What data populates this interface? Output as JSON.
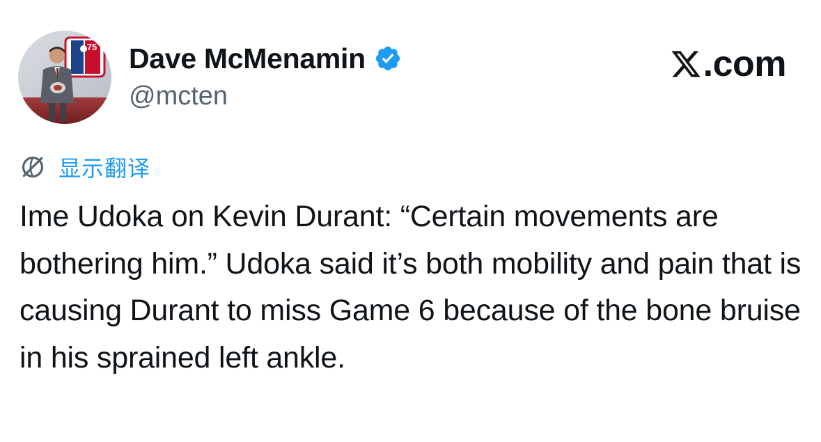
{
  "author": {
    "display_name": "Dave McMenamin",
    "handle": "@mcten",
    "verified": true,
    "avatar_badge_text": "75"
  },
  "brand": {
    "label": ".com",
    "icon": "x-logo-icon"
  },
  "translate": {
    "label": "显示翻译",
    "icon": "globe-translate-icon"
  },
  "tweet": {
    "text": "Ime Udoka on Kevin Durant: “Certain movements are bothering him.” Udoka said it’s both mobility and pain that is causing Durant to miss Game 6 because of the bone bruise in his sprained left ankle."
  },
  "colors": {
    "text": "#0f1419",
    "secondary": "#536471",
    "accent": "#1d9bf0"
  }
}
